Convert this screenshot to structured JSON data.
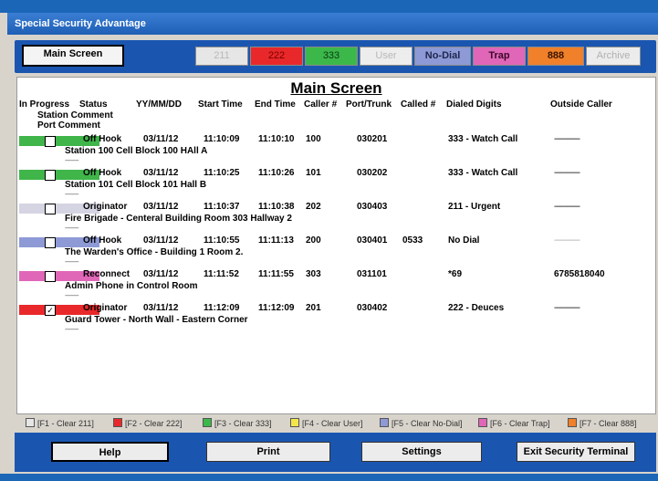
{
  "window": {
    "title": "Special Security Advantage"
  },
  "toolbar": {
    "main_tab": "Main Screen",
    "buttons": [
      "211",
      "222",
      "333",
      "User",
      "No-Dial",
      "Trap",
      "888",
      "Archive"
    ]
  },
  "main": {
    "title": "Main Screen",
    "headers": {
      "in_progress": "In Progress",
      "status": "Status",
      "date": "YY/MM/DD",
      "start": "Start Time",
      "end": "End Time",
      "caller": "Caller #",
      "port_trunk": "Port/Trunk",
      "called": "Called #",
      "dialed": "Dialed Digits",
      "outside": "Outside Caller",
      "station_comment": "Station Comment",
      "port_comment": "Port Comment"
    },
    "rows": [
      {
        "color": "#3fb54a",
        "checked": "",
        "status": "Off Hook",
        "date": "03/11/12",
        "start": "11:10:09",
        "end": "11:10:10",
        "caller": "100",
        "port": "030201",
        "called": "",
        "dialed": "333 - Watch Call",
        "outside": "------------",
        "station": "Station 100 Cell Block 100 HAll A",
        "port_comment": "-----------"
      },
      {
        "color": "#3fb54a",
        "checked": "",
        "status": "Off Hook",
        "date": "03/11/12",
        "start": "11:10:25",
        "end": "11:10:26",
        "caller": "101",
        "port": "030202",
        "called": "",
        "dialed": "333 - Watch Call",
        "outside": "------------",
        "station": "Station 101 Cell Block 101 Hall B",
        "port_comment": "-----------"
      },
      {
        "color": "#d4d4e2",
        "checked": "",
        "status": "Originator",
        "date": "03/11/12",
        "start": "11:10:37",
        "end": "11:10:38",
        "caller": "202",
        "port": "030403",
        "called": "",
        "dialed": "211 - Urgent",
        "outside": "------------",
        "station": "Fire Brigade - Centeral Building Room 303 Hallway 2",
        "port_comment": "-----------"
      },
      {
        "color": "#8e9ad6",
        "checked": "",
        "status": "Off Hook",
        "date": "03/11/12",
        "start": "11:10:55",
        "end": "11:11:13",
        "caller": "200",
        "port": "030401",
        "called": "0533",
        "dialed": "No Dial",
        "outside": "------------",
        "station": "The Warden's Office - Building 1 Room 2.",
        "port_comment": "-----------"
      },
      {
        "color": "#e066b8",
        "checked": "",
        "status": "Reconnect",
        "date": "03/11/12",
        "start": "11:11:52",
        "end": "11:11:55",
        "caller": "303",
        "port": "031101",
        "called": "",
        "dialed": "*69",
        "outside": "6785818040",
        "station": "Admin Phone in Control Room",
        "port_comment": "-----------"
      },
      {
        "color": "#e8282a",
        "checked": "✓",
        "status": "Originator",
        "date": "03/11/12",
        "start": "11:12:09",
        "end": "11:12:09",
        "caller": "201",
        "port": "030402",
        "called": "",
        "dialed": "222 - Deuces",
        "outside": "------------",
        "station": "Guard Tower - North Wall - Eastern Corner",
        "port_comment": "-----------"
      }
    ]
  },
  "legend": [
    {
      "label": "[F1 - Clear 211]",
      "color": "#e6e6e6"
    },
    {
      "label": "[F2 - Clear 222]",
      "color": "#e8282a"
    },
    {
      "label": "[F3 - Clear 333]",
      "color": "#3cb84a"
    },
    {
      "label": "[F4 - Clear User]",
      "color": "#f2e64a"
    },
    {
      "label": "[F5 - Clear No-Dial]",
      "color": "#8e9ad6"
    },
    {
      "label": "[F6 - Clear Trap]",
      "color": "#e066b8"
    },
    {
      "label": "[F7 - Clear 888]",
      "color": "#f0802a"
    }
  ],
  "footer": {
    "help": "Help",
    "print": "Print",
    "settings": "Settings",
    "exit": "Exit Security Terminal"
  }
}
